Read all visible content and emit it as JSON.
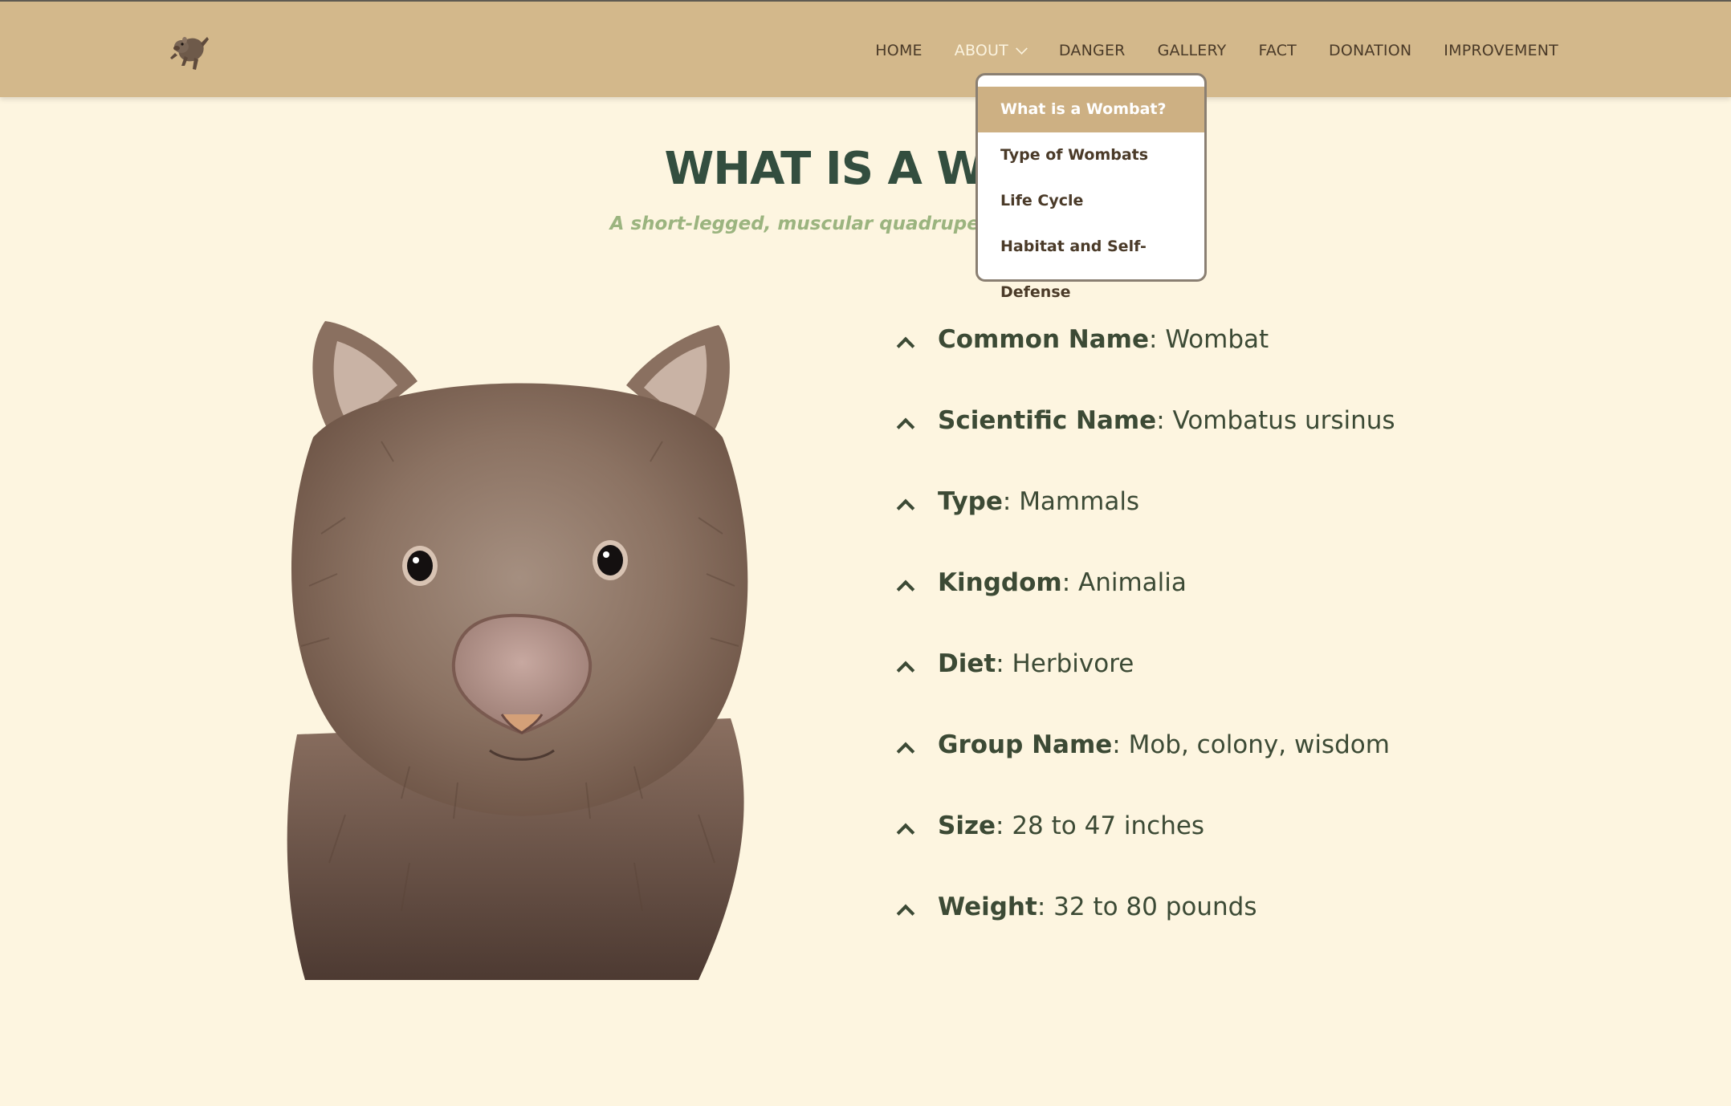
{
  "nav": {
    "logo_icon": "wombat-logo-icon",
    "items": [
      {
        "label": "HOME"
      },
      {
        "label": "ABOUT"
      },
      {
        "label": "DANGER"
      },
      {
        "label": "GALLERY"
      },
      {
        "label": "FACT"
      },
      {
        "label": "DONATION"
      },
      {
        "label": "IMPROVEMENT"
      }
    ],
    "active": "ABOUT"
  },
  "dropdown": {
    "items": [
      {
        "label": "What is a Wombat?"
      },
      {
        "label": "Type of Wombats"
      },
      {
        "label": "Life Cycle"
      },
      {
        "label": "Habitat and Self-Defense"
      }
    ],
    "selected": "What is a Wombat?"
  },
  "main": {
    "title": "WHAT IS A WOM",
    "subtitle": "A short-legged, muscular quadrupedal marsupial",
    "image_icon": "wombat-illustration",
    "facts": [
      {
        "label": "Common Name",
        "value": ": Wombat"
      },
      {
        "label": "Scientific Name",
        "value": ": Vombatus ursinus"
      },
      {
        "label": "Type",
        "value": ": Mammals"
      },
      {
        "label": "Kingdom",
        "value": ": Animalia"
      },
      {
        "label": "Diet",
        "value": ": Herbivore"
      },
      {
        "label": "Group Name",
        "value": ": Mob, colony, wisdom"
      },
      {
        "label": "Size",
        "value": ": 28 to 47 inches"
      },
      {
        "label": "Weight",
        "value": ": 32 to 80 pounds"
      }
    ]
  },
  "colors": {
    "header_bg": "#d3b88b",
    "page_bg": "#fdf5e0",
    "title": "#334e3f",
    "subtitle": "#9bb47f",
    "dropdown_selected": "#cdb083"
  }
}
